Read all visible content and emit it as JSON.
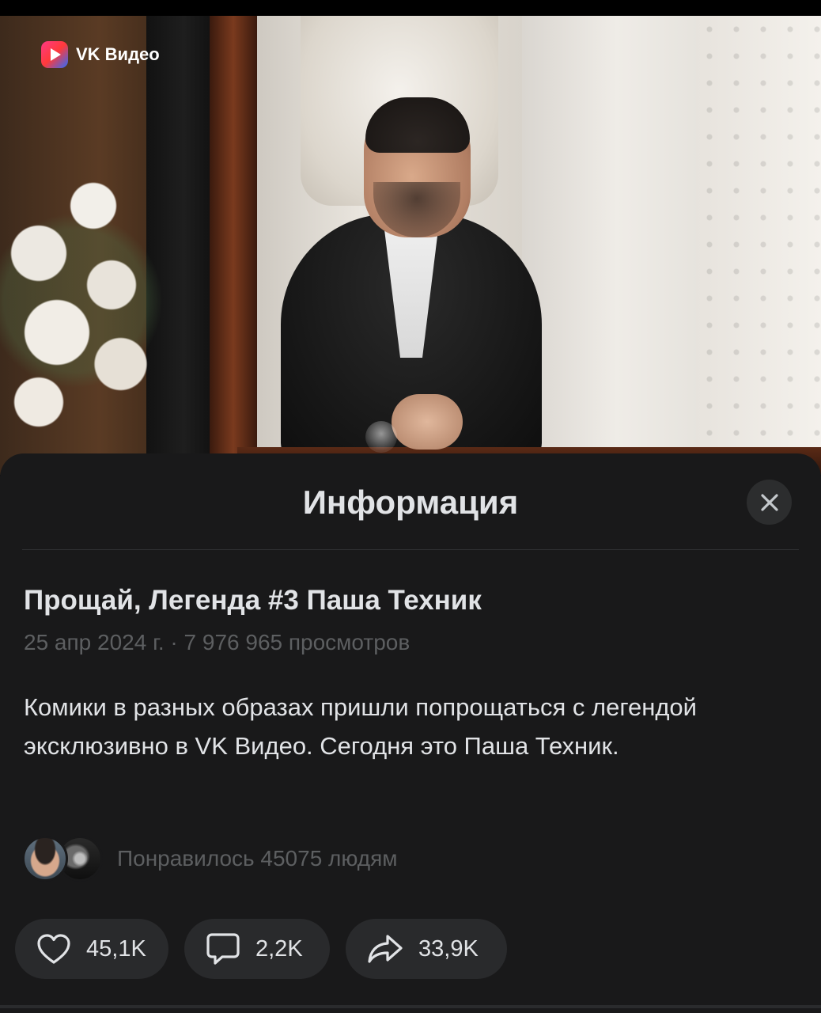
{
  "player": {
    "brand_label": "VK Видео",
    "brand_icon": "vk-video-logo-icon"
  },
  "info_sheet": {
    "title": "Информация",
    "close_icon": "close-icon",
    "video": {
      "title": "Прощай, Легенда #3 Паша Техник",
      "meta": "25 апр 2024 г. · 7 976 965 просмотров",
      "description": "Комики в разных образах пришли попрощаться с легендой эксклюзивно в VK Видео. Сегодня это Паша Техник."
    },
    "likes_summary": {
      "text": "Понравилось 45075 людям"
    },
    "actions": [
      {
        "label": "45,1K",
        "icon": "heart-icon"
      },
      {
        "label": "2,2K",
        "icon": "comment-icon"
      },
      {
        "label": "33,9K",
        "icon": "share-icon"
      }
    ]
  },
  "colors": {
    "sheet_background": "#19191a",
    "button_background": "#292a2c",
    "primary_text": "#e1e3e6",
    "secondary_text": "#5d5f61"
  }
}
